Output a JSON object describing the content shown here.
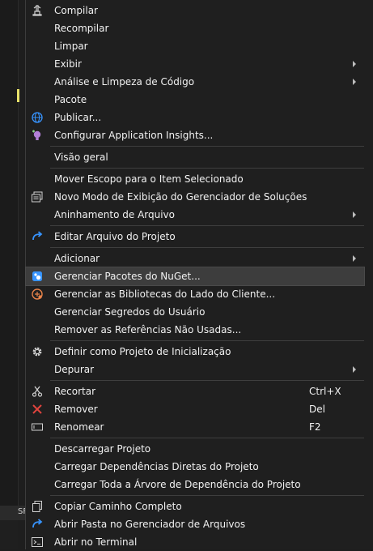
{
  "left_panel": {
    "bottom_text": "SF"
  },
  "menu": {
    "compilar": "Compilar",
    "recompilar": "Recompilar",
    "limpar": "Limpar",
    "exibir": "Exibir",
    "analise": "Análise e Limpeza de Código",
    "pacote": "Pacote",
    "publicar": "Publicar...",
    "config_insights": "Configurar Application Insights...",
    "visao_geral": "Visão geral",
    "mover_escopo": "Mover Escopo para o Item Selecionado",
    "novo_modo": "Novo Modo de Exibição do Gerenciador de Soluções",
    "aninhamento": "Aninhamento de Arquivo",
    "editar_projeto": "Editar Arquivo do Projeto",
    "adicionar": "Adicionar",
    "gerenciar_nuget": "Gerenciar Pacotes do NuGet...",
    "gerenciar_bibliotecas": "Gerenciar as Bibliotecas do Lado do Cliente...",
    "gerenciar_segredos": "Gerenciar Segredos do Usuário",
    "remover_refs": "Remover as Referências Não Usadas...",
    "definir_inicializacao": "Definir como Projeto de Inicialização",
    "depurar": "Depurar",
    "recortar": "Recortar",
    "recortar_shortcut": "Ctrl+X",
    "remover": "Remover",
    "remover_shortcut": "Del",
    "renomear": "Renomear",
    "renomear_shortcut": "F2",
    "descarregar": "Descarregar Projeto",
    "carregar_diretas": "Carregar Dependências Diretas do Projeto",
    "carregar_arvore": "Carregar Toda a Árvore de Dependência do Projeto",
    "copiar_caminho": "Copiar Caminho Completo",
    "abrir_pasta": "Abrir Pasta no Gerenciador de Arquivos",
    "abrir_terminal": "Abrir no Terminal"
  },
  "colors": {
    "menu_bg": "#1f1f1f",
    "highlight": "#3d3d3d",
    "accent_blue": "#3794ff",
    "remove_red": "#e0443e"
  }
}
